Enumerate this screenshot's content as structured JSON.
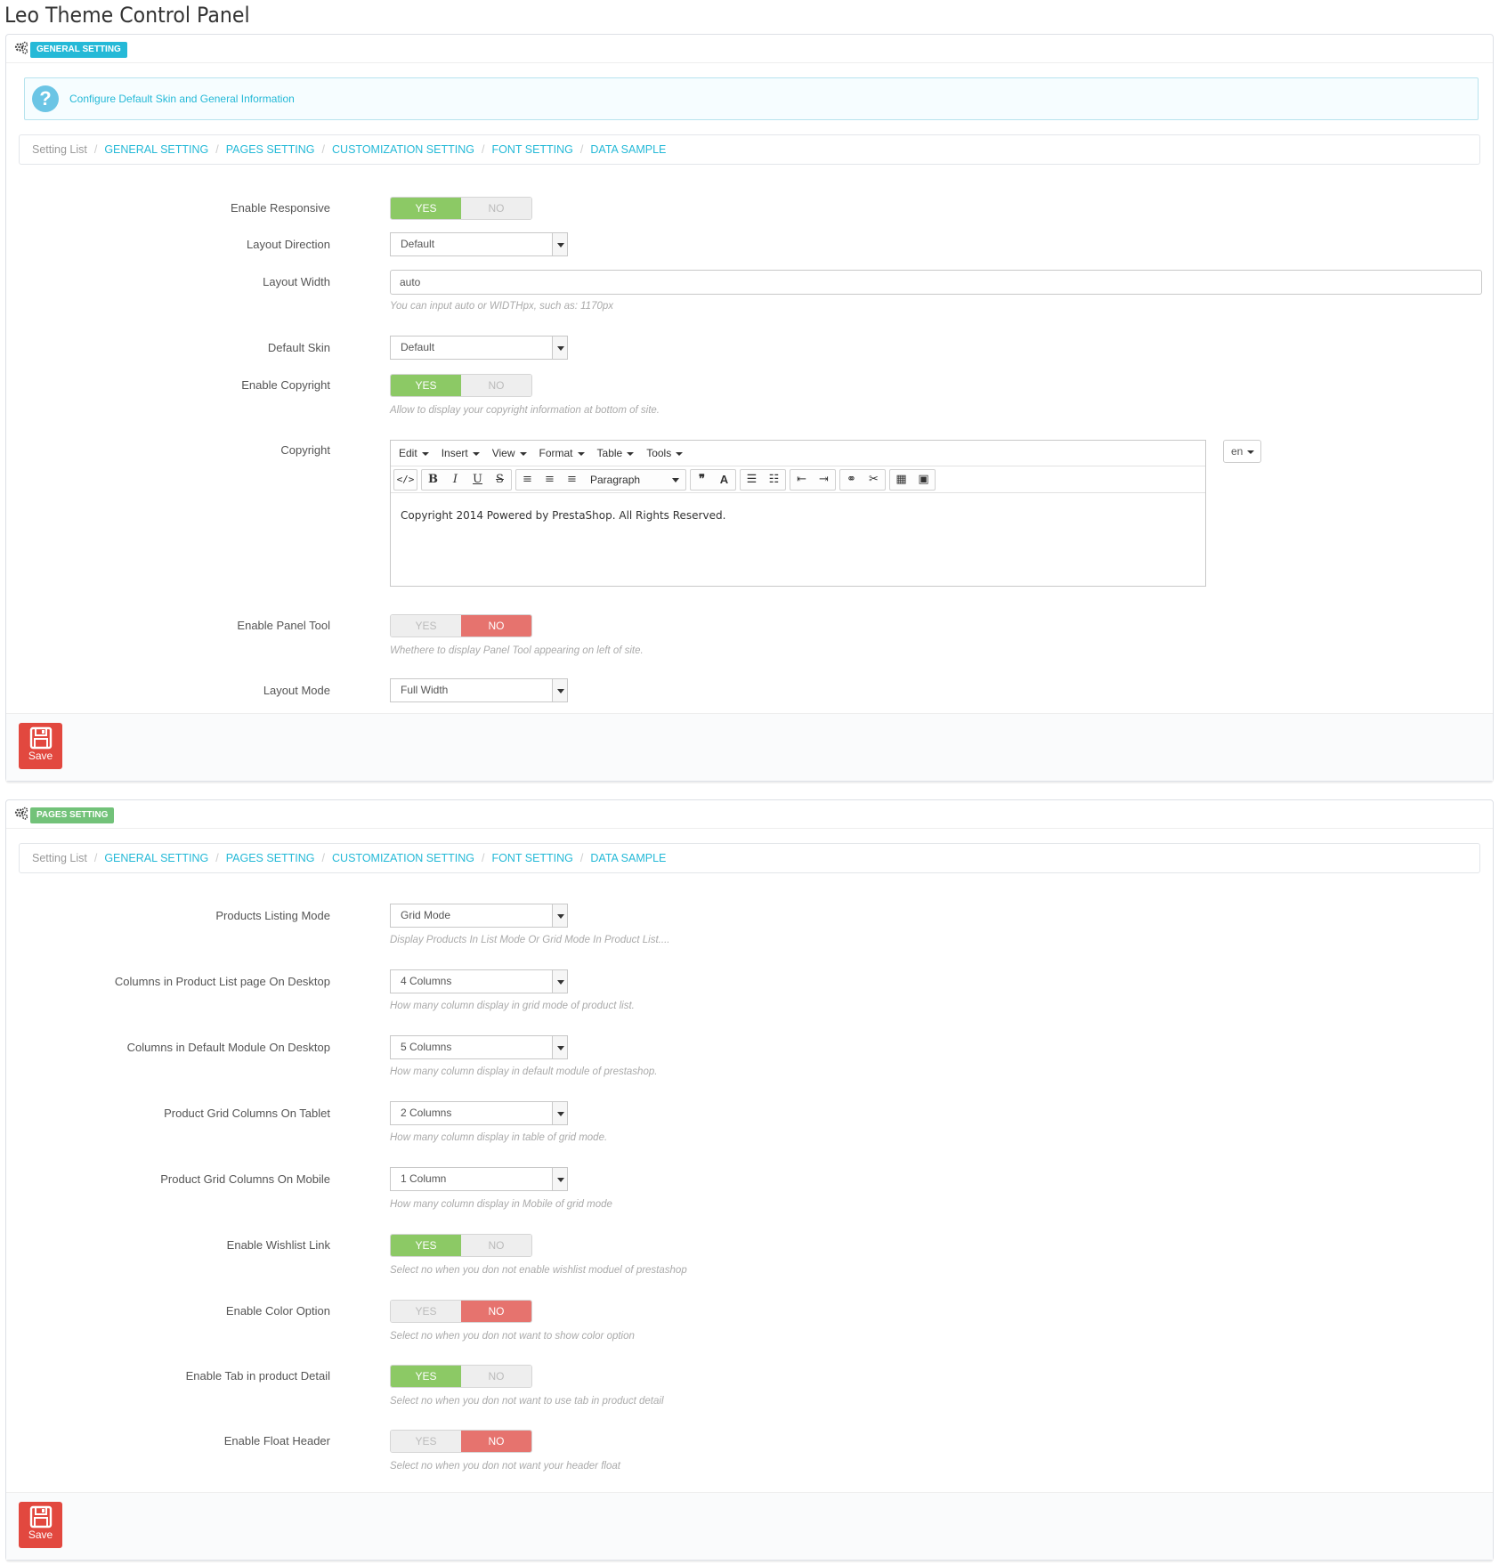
{
  "page": {
    "title": "Leo Theme Control Panel"
  },
  "colors": {
    "accent": "#25b9d7",
    "yes": "#8cc965",
    "no": "#e6736e",
    "save": "#e2483f"
  },
  "breadcrumb": [
    "Setting List",
    "GENERAL SETTING",
    "PAGES SETTING",
    "CUSTOMIZATION SETTING",
    "FONT SETTING",
    "DATA SAMPLE"
  ],
  "general": {
    "badge": "GENERAL SETTING",
    "info": "Configure Default Skin and General Information",
    "enable_responsive": {
      "label": "Enable Responsive",
      "yes": "YES",
      "no": "NO",
      "value": "YES"
    },
    "layout_direction": {
      "label": "Layout Direction",
      "value": "Default"
    },
    "layout_width": {
      "label": "Layout Width",
      "value": "auto",
      "help": "You can input auto or WIDTHpx, such as: 1170px"
    },
    "default_skin": {
      "label": "Default Skin",
      "value": "Default"
    },
    "enable_copyright": {
      "label": "Enable Copyright",
      "yes": "YES",
      "no": "NO",
      "value": "YES",
      "help": "Allow to display your copyright information at bottom of site."
    },
    "copyright": {
      "label": "Copyright",
      "menu": [
        "Edit",
        "Insert",
        "View",
        "Format",
        "Table",
        "Tools"
      ],
      "format_select": "Paragraph",
      "content": "Copyright 2014 Powered by PrestaShop. All Rights Reserved.",
      "lang": "en"
    },
    "enable_panel_tool": {
      "label": "Enable Panel Tool",
      "yes": "YES",
      "no": "NO",
      "value": "NO",
      "help": "Whethere to display Panel Tool appearing on left of site."
    },
    "layout_mode": {
      "label": "Layout Mode",
      "value": "Full Width"
    },
    "save": "Save"
  },
  "pages": {
    "badge": "PAGES SETTING",
    "products_listing_mode": {
      "label": "Products Listing Mode",
      "value": "Grid Mode",
      "help": "Display Products In List Mode Or Grid Mode In Product List...."
    },
    "cols_product_list_desktop": {
      "label": "Columns in Product List page On Desktop",
      "value": "4 Columns",
      "help": "How many column display in grid mode of product list."
    },
    "cols_default_module_desktop": {
      "label": "Columns in Default Module On Desktop",
      "value": "5 Columns",
      "help": "How many column display in default module of prestashop."
    },
    "grid_cols_tablet": {
      "label": "Product Grid Columns On Tablet",
      "value": "2 Columns",
      "help": "How many column display in table of grid mode."
    },
    "grid_cols_mobile": {
      "label": "Product Grid Columns On Mobile",
      "value": "1 Column",
      "help": "How many column display in Mobile of grid mode"
    },
    "enable_wishlist": {
      "label": "Enable Wishlist Link",
      "yes": "YES",
      "no": "NO",
      "value": "YES",
      "help": "Select no when you don not enable wishlist moduel of prestashop"
    },
    "enable_color": {
      "label": "Enable Color Option",
      "yes": "YES",
      "no": "NO",
      "value": "NO",
      "help": "Select no when you don not want to show color option"
    },
    "enable_tab": {
      "label": "Enable Tab in product Detail",
      "yes": "YES",
      "no": "NO",
      "value": "YES",
      "help": "Select no when you don not want to use tab in product detail"
    },
    "enable_float_header": {
      "label": "Enable Float Header",
      "yes": "YES",
      "no": "NO",
      "value": "NO",
      "help": "Select no when you don not want your header float"
    },
    "save": "Save"
  }
}
